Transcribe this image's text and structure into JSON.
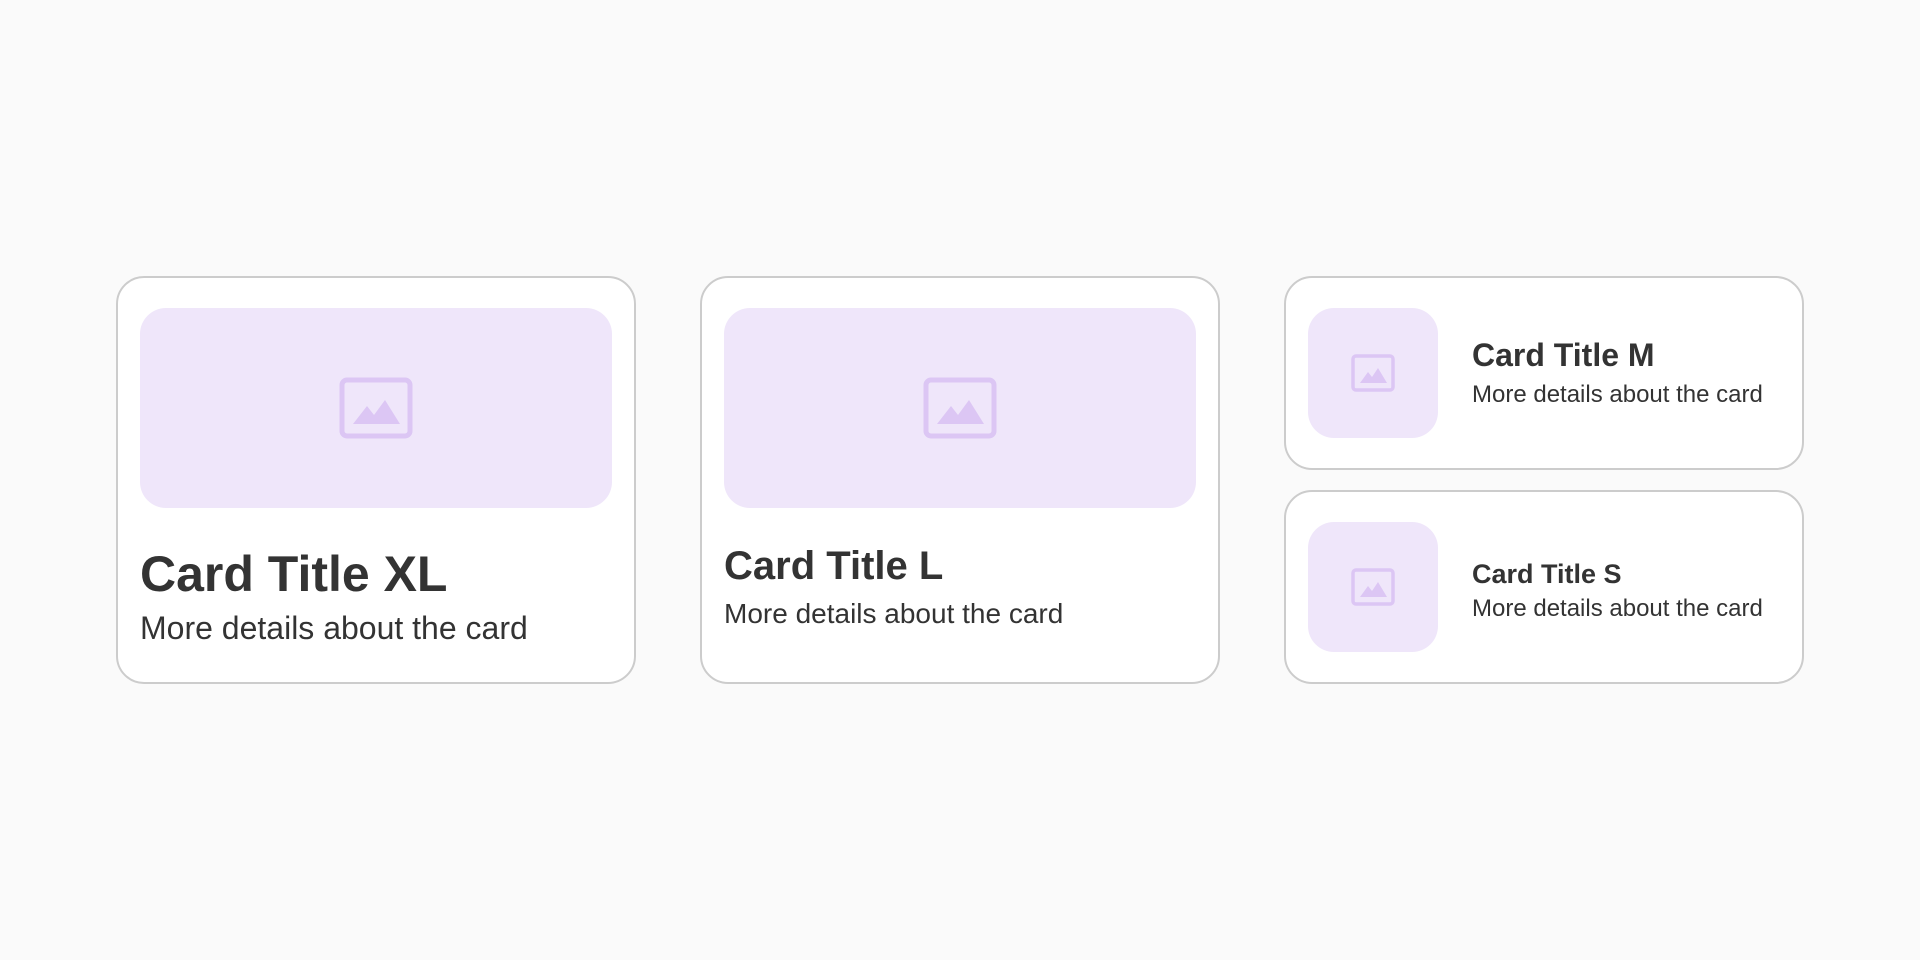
{
  "colors": {
    "page_background": "#fafafa",
    "card_background": "#ffffff",
    "card_border": "#cccccc",
    "media_background": "#efe6fa",
    "icon_color": "#dcc6f4",
    "text_color": "#333333"
  },
  "cards": [
    {
      "size": "XL",
      "title": "Card Title XL",
      "description": "More details about the card",
      "icon": "image-icon",
      "media_layout": "wide-top"
    },
    {
      "size": "L",
      "title": "Card Title L",
      "description": "More details about the card",
      "icon": "image-icon",
      "media_layout": "wide-top"
    },
    {
      "size": "M",
      "title": "Card Title M",
      "description": "More details about the card",
      "icon": "image-icon",
      "media_layout": "square-left"
    },
    {
      "size": "S",
      "title": "Card Title S",
      "description": "More details about the card",
      "icon": "image-icon",
      "media_layout": "square-left"
    }
  ]
}
